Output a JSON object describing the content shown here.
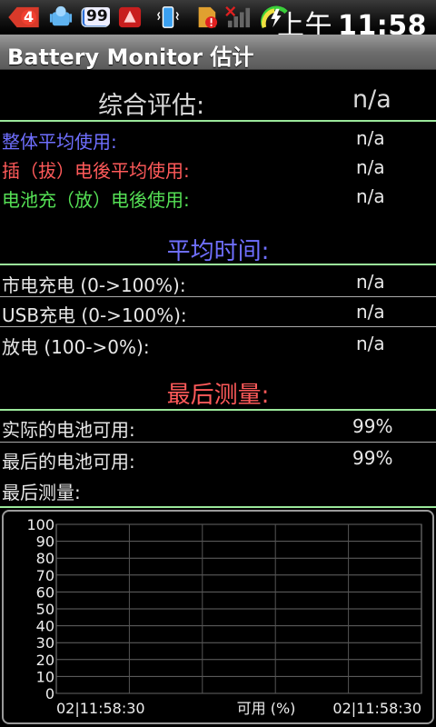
{
  "statusbar": {
    "notif_count": "4",
    "badge_99": "99",
    "time_ampm": "上午",
    "time": "11:58"
  },
  "app": {
    "title": "Battery Monitor 估计"
  },
  "overall": {
    "heading": "综合评估:",
    "value": "n/a",
    "rows": [
      {
        "label": "整体平均使用:",
        "value": "n/a",
        "color": "#6f6fff"
      },
      {
        "label": "插（拔）电後平均使用:",
        "value": "n/a",
        "color": "#ff5a5a"
      },
      {
        "label": "电池充（放）电後使用:",
        "value": "n/a",
        "color": "#55e055"
      }
    ]
  },
  "avg_time": {
    "heading": "平均时间:",
    "heading_color": "#6f6fff",
    "rows": [
      {
        "label": "市电充电 (0->100%):",
        "value": "n/a"
      },
      {
        "label": "USB充电 (0->100%):",
        "value": "n/a"
      },
      {
        "label": "放电 (100->0%):",
        "value": "n/a"
      }
    ]
  },
  "last_measure": {
    "heading": "最后测量:",
    "heading_color": "#ff5a5a",
    "rows": [
      {
        "label": "实际的电池可用:",
        "value": "99%"
      },
      {
        "label": "最后的电池可用:",
        "value": "99%"
      },
      {
        "label": "最后测量:",
        "value": ""
      }
    ]
  },
  "chart_data": {
    "type": "line",
    "title": "",
    "xlabel": "可用 (%)",
    "ylabel": "",
    "ylim": [
      0,
      100
    ],
    "yticks": [
      "0",
      "10",
      "20",
      "30",
      "40",
      "50",
      "60",
      "70",
      "80",
      "90",
      "100"
    ],
    "x_start_label": "02|11:58:30",
    "x_end_label": "02|11:58:30",
    "grid": true,
    "series": []
  }
}
